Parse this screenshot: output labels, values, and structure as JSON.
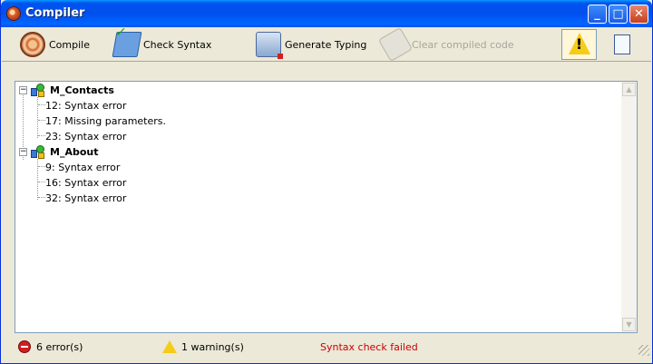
{
  "window": {
    "title": "Compiler"
  },
  "toolbar": {
    "compile_label": "Compile",
    "check_syntax_label": "Check Syntax",
    "generate_typing_label": "Generate Typing",
    "clear_compiled_label": "Clear compiled code"
  },
  "tree": {
    "nodes": [
      {
        "label": "M_Contacts",
        "expanded": true,
        "children": [
          "12: Syntax error",
          "17: Missing parameters.",
          "23: Syntax error"
        ]
      },
      {
        "label": "M_About",
        "expanded": true,
        "children": [
          "9: Syntax error",
          "16: Syntax error",
          "32: Syntax error"
        ]
      }
    ]
  },
  "status": {
    "errors": "6 error(s)",
    "warnings": "1 warning(s)",
    "message": "Syntax check failed"
  },
  "icons": {
    "compile": "compile-icon",
    "check_syntax": "check-syntax-icon",
    "generate_typing": "generate-typing-icon",
    "clear_compiled": "eraser-icon",
    "warnings_toggle": "warning-icon",
    "list_toggle": "checklist-icon"
  },
  "colors": {
    "titlebar": "#0053ee",
    "status_message": "#cc0000",
    "error": "#d02020",
    "warning": "#f5cc18"
  }
}
